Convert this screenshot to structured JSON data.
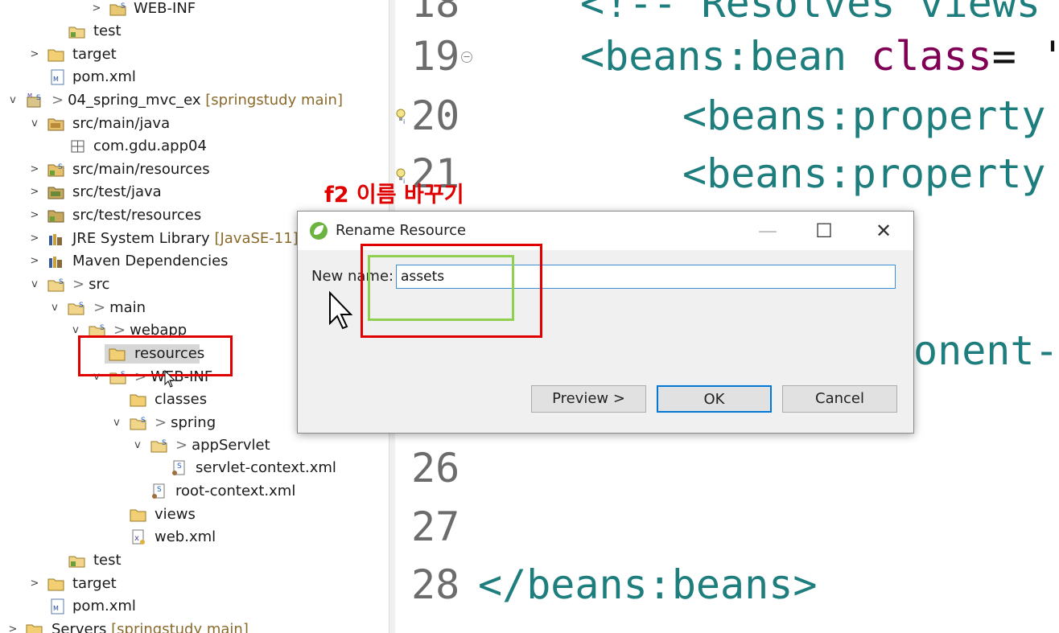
{
  "explorer": {
    "rows": [
      {
        "label": "WEB-INF"
      },
      {
        "label": "test"
      },
      {
        "label": "target"
      },
      {
        "label": "pom.xml"
      },
      {
        "label": "04_spring_mvc_ex",
        "decoration": "[springstudy main]"
      },
      {
        "label": "src/main/java"
      },
      {
        "label": "com.gdu.app04"
      },
      {
        "label": "src/main/resources"
      },
      {
        "label": "src/test/java"
      },
      {
        "label": "src/test/resources"
      },
      {
        "label": "JRE System Library",
        "decoration": "[JavaSE-11]"
      },
      {
        "label": "Maven Dependencies"
      },
      {
        "label": "src"
      },
      {
        "label": "main"
      },
      {
        "label": "webapp"
      },
      {
        "label": "resources"
      },
      {
        "label": "WEB-INF"
      },
      {
        "label": "classes"
      },
      {
        "label": "spring"
      },
      {
        "label": "appServlet"
      },
      {
        "label": "servlet-context.xml"
      },
      {
        "label": "root-context.xml"
      },
      {
        "label": "views"
      },
      {
        "label": "web.xml"
      },
      {
        "label": "test"
      },
      {
        "label": "target"
      },
      {
        "label": "pom.xml"
      },
      {
        "label": "Servers",
        "decoration": "[springstudy main]"
      }
    ]
  },
  "editor": {
    "line_numbers": [
      "18",
      "19",
      "20",
      "21",
      "26",
      "27",
      "28"
    ],
    "lines": {
      "l18": "<!-- Resolves views",
      "l19_tag": "<beans:bean ",
      "l19_attr": "class",
      "l19_eq": "= '",
      "l20": "<beans:property",
      "l21": "<beans:property",
      "partial": "onent-",
      "l28": "</beans:beans>"
    }
  },
  "annotation": {
    "hint": "f2 이름 바꾸기",
    "color": "#e00000"
  },
  "dialog": {
    "title": "Rename Resource",
    "minimize": "—",
    "maximize": "☐",
    "close": "✕",
    "new_name_label": "New name:",
    "new_name_value": "assets",
    "buttons": {
      "preview": "Preview >",
      "ok": "OK",
      "cancel": "Cancel"
    }
  },
  "colors": {
    "tag": "#1e7d7d",
    "attribute": "#7f0055",
    "highlight_red": "#e00000",
    "highlight_green": "#8fd14f",
    "focus_blue": "#0078d7"
  }
}
